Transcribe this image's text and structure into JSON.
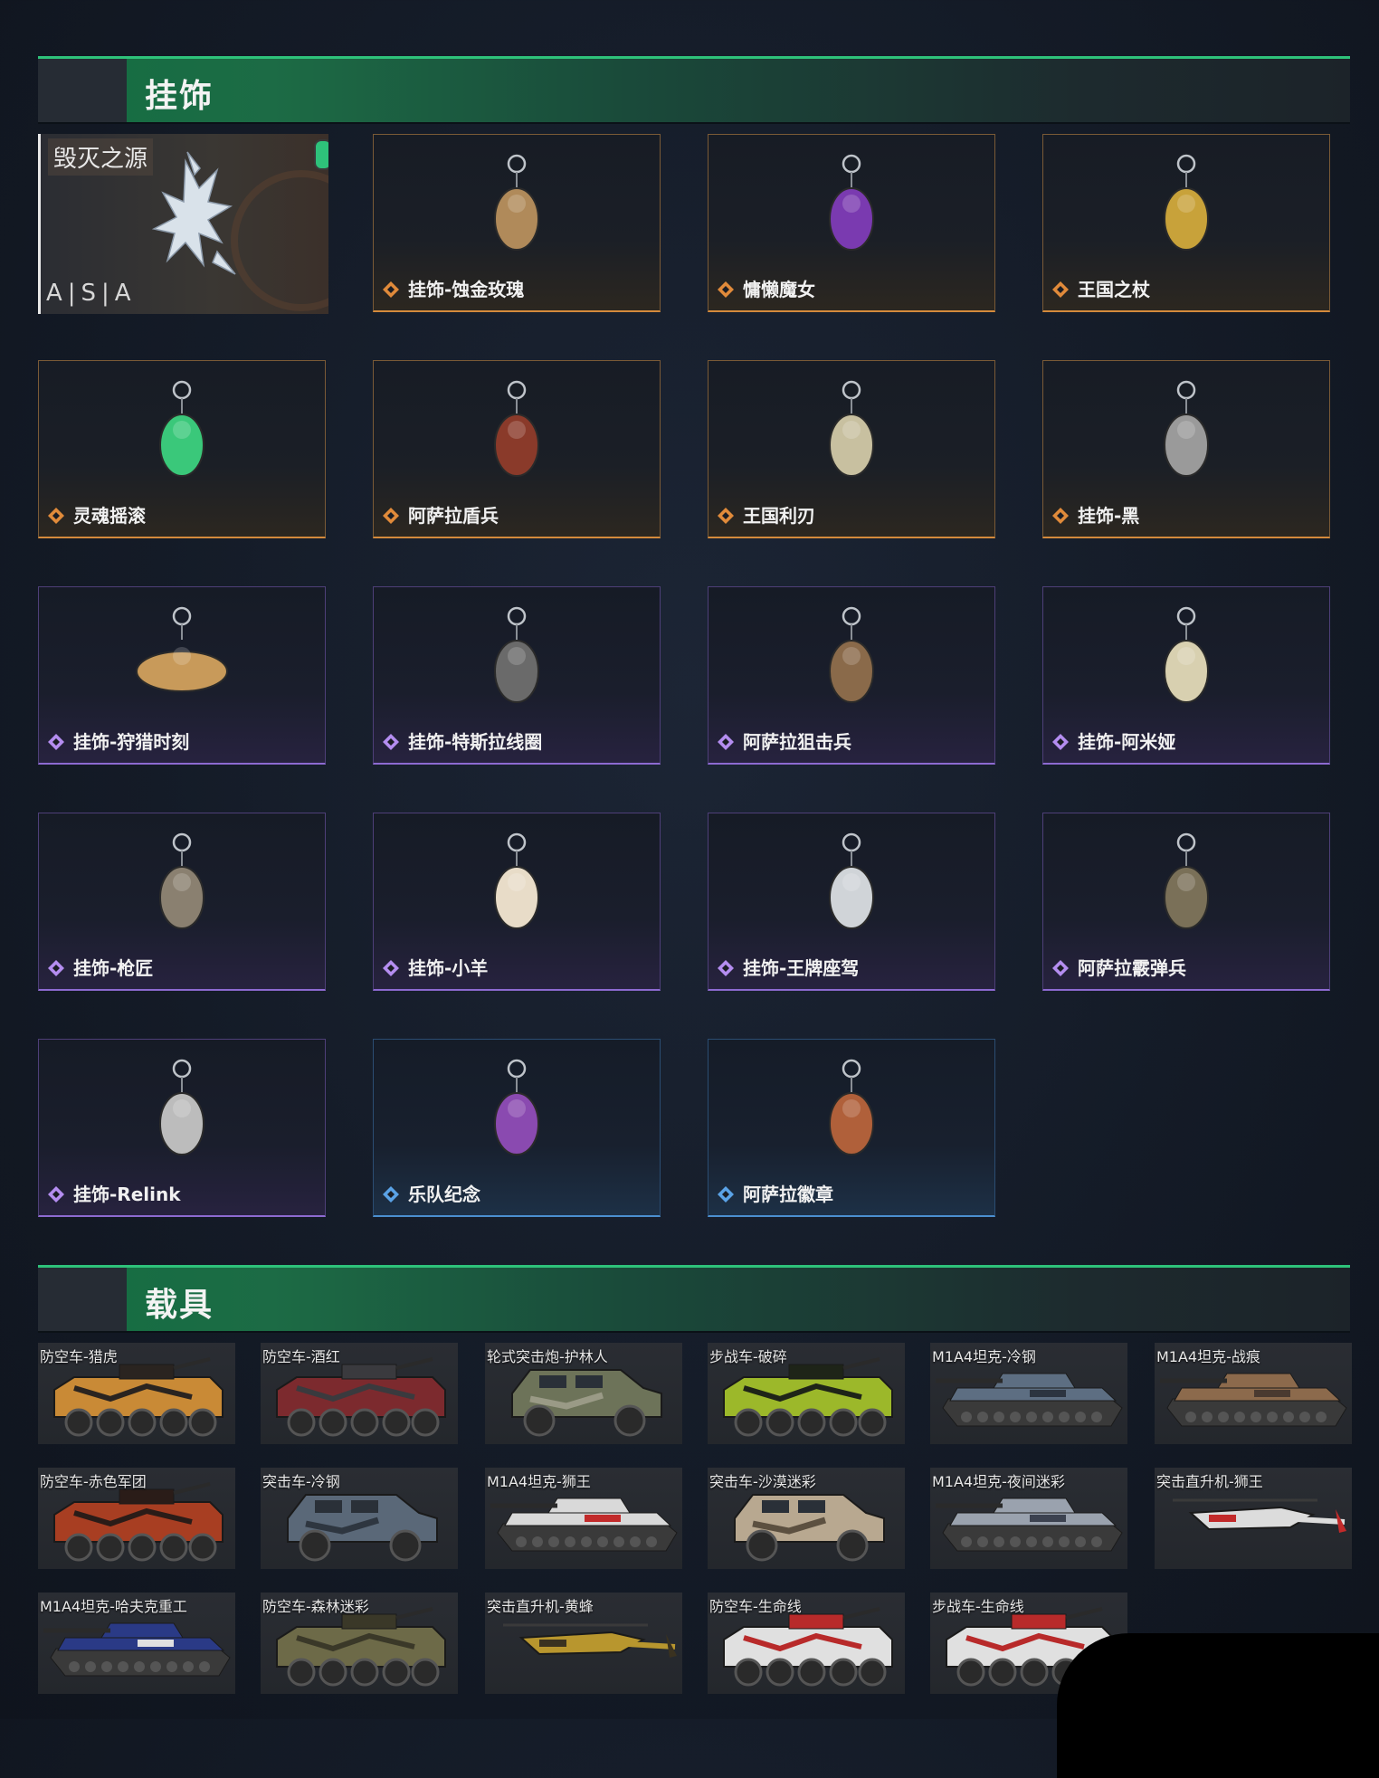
{
  "sections": {
    "charms": {
      "title": "挂饰"
    },
    "vehicles": {
      "title": "载具"
    }
  },
  "featured": {
    "title": "毁灭之源",
    "subtitle": "A|S|A"
  },
  "charms": [
    {
      "label": "挂饰-蚀金玫瑰",
      "rarity": "gold",
      "icon": "rose-charm-icon"
    },
    {
      "label": "慵懒魔女",
      "rarity": "gold",
      "icon": "witch-charm-icon"
    },
    {
      "label": "王国之杖",
      "rarity": "gold",
      "icon": "scepter-charm-icon"
    },
    {
      "label": "灵魂摇滚",
      "rarity": "gold",
      "icon": "guitarist-charm-icon"
    },
    {
      "label": "阿萨拉盾兵",
      "rarity": "gold",
      "icon": "shield-soldier-charm-icon"
    },
    {
      "label": "王国利刃",
      "rarity": "gold",
      "icon": "knight-charm-icon"
    },
    {
      "label": "挂饰-黑",
      "rarity": "gold",
      "icon": "tag-charm-icon"
    },
    {
      "label": "挂饰-狩猎时刻",
      "rarity": "purple",
      "icon": "antler-charm-icon"
    },
    {
      "label": "挂饰-特斯拉线圈",
      "rarity": "purple",
      "icon": "tesla-coil-charm-icon"
    },
    {
      "label": "阿萨拉狙击兵",
      "rarity": "purple",
      "icon": "sniper-charm-icon"
    },
    {
      "label": "挂饰-阿米娅",
      "rarity": "purple",
      "icon": "rabbit-charm-icon"
    },
    {
      "label": "挂饰-枪匠",
      "rarity": "purple",
      "icon": "gunsmith-charm-icon"
    },
    {
      "label": "挂饰-小羊",
      "rarity": "purple",
      "icon": "lamb-charm-icon"
    },
    {
      "label": "挂饰-王牌座驾",
      "rarity": "purple",
      "icon": "jet-charm-icon"
    },
    {
      "label": "阿萨拉霰弹兵",
      "rarity": "purple",
      "icon": "shotgunner-charm-icon"
    },
    {
      "label": "挂饰-Relink",
      "rarity": "purple",
      "icon": "relink-charm-icon"
    },
    {
      "label": "乐队纪念",
      "rarity": "blue",
      "icon": "band-medal-charm-icon"
    },
    {
      "label": "阿萨拉徽章",
      "rarity": "blue",
      "icon": "badge-charm-icon"
    }
  ],
  "vehicles": [
    {
      "label": "防空车-猎虎",
      "type": "wheeled",
      "color": "#c98a36",
      "accent": "#2a2420"
    },
    {
      "label": "防空车-酒红",
      "type": "wheeled",
      "color": "#7c2a2e",
      "accent": "#3a3a3e"
    },
    {
      "label": "轮式突击炮-护林人",
      "type": "jeep",
      "color": "#6d7359",
      "accent": "#9a9a86"
    },
    {
      "label": "步战车-破碎",
      "type": "wheeled",
      "color": "#9cb82a",
      "accent": "#1e2418"
    },
    {
      "label": "M1A4坦克-冷钢",
      "type": "tank",
      "color": "#5d6e82",
      "accent": "#2c3440"
    },
    {
      "label": "M1A4坦克-战痕",
      "type": "tank",
      "color": "#8c6a4c",
      "accent": "#4a3a30"
    },
    {
      "label": "防空车-赤色军团",
      "type": "wheeled",
      "color": "#a83e22",
      "accent": "#2a1c18"
    },
    {
      "label": "突击车-冷钢",
      "type": "jeep",
      "color": "#5a6878",
      "accent": "#2e3640"
    },
    {
      "label": "M1A4坦克-狮王",
      "type": "tank",
      "color": "#d9d9d9",
      "accent": "#c22a2a"
    },
    {
      "label": "突击车-沙漠迷彩",
      "type": "jeep",
      "color": "#b8a890",
      "accent": "#5c5040"
    },
    {
      "label": "M1A4坦克-夜间迷彩",
      "type": "tank",
      "color": "#9aa2ae",
      "accent": "#3c4250"
    },
    {
      "label": "突击直升机-狮王",
      "type": "heli",
      "color": "#dcdcdc",
      "accent": "#c22a2a"
    },
    {
      "label": "M1A4坦克-哈夫克重工",
      "type": "tank",
      "color": "#2a3a86",
      "accent": "#e0e0e0"
    },
    {
      "label": "防空车-森林迷彩",
      "type": "wheeled",
      "color": "#6d6a48",
      "accent": "#3a3828"
    },
    {
      "label": "突击直升机-黄蜂",
      "type": "heli",
      "color": "#b8962e",
      "accent": "#3a3220"
    },
    {
      "label": "防空车-生命线",
      "type": "wheeled",
      "color": "#e0e0e0",
      "accent": "#b82a2a"
    },
    {
      "label": "步战车-生命线",
      "type": "wheeled",
      "color": "#e0e0e0",
      "accent": "#b82a2a"
    }
  ]
}
